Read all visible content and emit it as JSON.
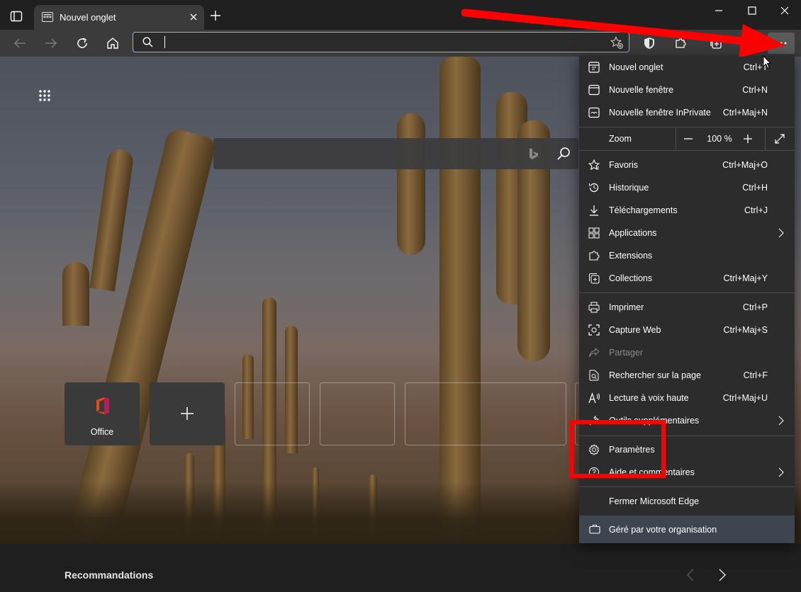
{
  "tab": {
    "title": "Nouvel onglet"
  },
  "address": {
    "value": ""
  },
  "menu": {
    "group1": [
      {
        "label": "Nouvel onglet",
        "shortcut": "Ctrl+T",
        "icon": "new-tab-icon"
      },
      {
        "label": "Nouvelle fenêtre",
        "shortcut": "Ctrl+N",
        "icon": "new-window-icon"
      },
      {
        "label": "Nouvelle fenêtre InPrivate",
        "shortcut": "Ctrl+Maj+N",
        "icon": "inprivate-icon"
      }
    ],
    "zoom": {
      "label": "Zoom",
      "value": "100 %"
    },
    "group2": [
      {
        "label": "Favoris",
        "shortcut": "Ctrl+Maj+O",
        "icon": "favorites-icon"
      },
      {
        "label": "Historique",
        "shortcut": "Ctrl+H",
        "icon": "history-icon"
      },
      {
        "label": "Téléchargements",
        "shortcut": "Ctrl+J",
        "icon": "download-icon"
      },
      {
        "label": "Applications",
        "shortcut": "",
        "icon": "apps-icon"
      },
      {
        "label": "Extensions",
        "shortcut": "",
        "icon": "extensions-icon"
      },
      {
        "label": "Collections",
        "shortcut": "Ctrl+Maj+Y",
        "icon": "collections-icon"
      }
    ],
    "group3": [
      {
        "label": "Imprimer",
        "shortcut": "Ctrl+P",
        "icon": "print-icon"
      },
      {
        "label": "Capture Web",
        "shortcut": "Ctrl+Maj+S",
        "icon": "web-capture-icon"
      },
      {
        "label": "Partager",
        "shortcut": "",
        "icon": "share-icon"
      },
      {
        "label": "Rechercher sur la page",
        "shortcut": "Ctrl+F",
        "icon": "find-icon"
      },
      {
        "label": "Lecture à voix haute",
        "shortcut": "Ctrl+Maj+U",
        "icon": "read-aloud-icon"
      },
      {
        "label": "Outils supplémentaires",
        "shortcut": "",
        "icon": "tools-icon"
      }
    ],
    "group4": [
      {
        "label": "Paramètres",
        "shortcut": "",
        "icon": "settings-icon"
      },
      {
        "label": "Aide et commentaires",
        "shortcut": "",
        "icon": "help-icon"
      }
    ],
    "close_label": "Fermer Microsoft Edge",
    "managed_label": "Géré par votre organisation"
  },
  "tiles": {
    "office_label": "Office"
  },
  "recommendations": {
    "label": "Recommandations"
  },
  "colors": {
    "accent": "#7ab7ff",
    "highlight": "#ff0000",
    "menu_bg": "#2c2c2c"
  }
}
